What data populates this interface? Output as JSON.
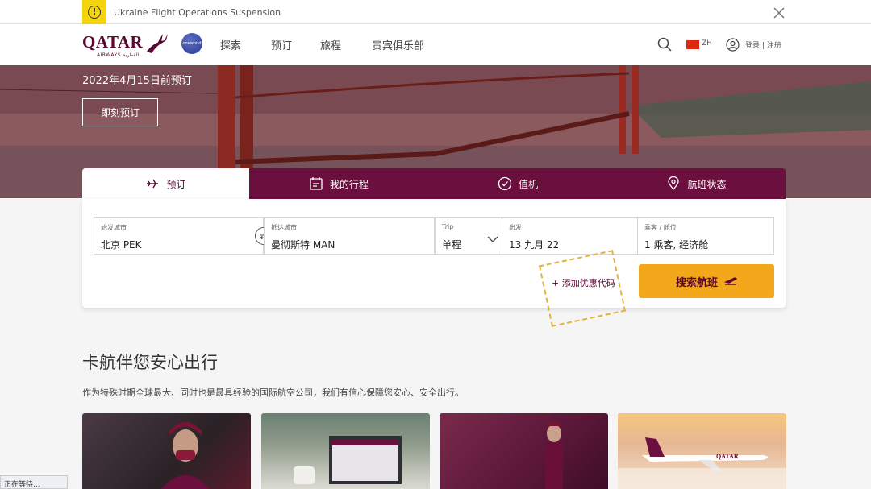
{
  "alert": {
    "text": "Ukraine Flight Operations Suspension",
    "icon": "warning-icon",
    "color": "#f4d40f"
  },
  "header": {
    "logo": "QATAR",
    "logo_sub": "AIRWAYS القطرية",
    "alliance": "oneworld",
    "nav": [
      "探索",
      "预订",
      "旅程",
      "贵宾俱乐部"
    ],
    "lang": "ZH",
    "login": "登录 | 注册"
  },
  "hero": {
    "date": "2022年4月15日前预订",
    "button": "即刻预订"
  },
  "tabs": [
    {
      "label": "预订",
      "icon": "plane-icon"
    },
    {
      "label": "我的行程",
      "icon": "itinerary-icon"
    },
    {
      "label": "值机",
      "icon": "checkin-icon"
    },
    {
      "label": "航班状态",
      "icon": "location-pin-icon"
    }
  ],
  "booking": {
    "from_label": "始发城市",
    "from_value": "北京 PEK",
    "to_label": "抵达城市",
    "to_value": "曼彻斯特 MAN",
    "trip_label": "Trip",
    "trip_value": "单程",
    "depart_label": "出发",
    "depart_value": "13 九月 22",
    "pax_label": "乘客 / 舱位",
    "pax_value": "1 乘客, 经济舱",
    "promo": "+ 添加优惠代码",
    "search": "搜索航班"
  },
  "section": {
    "title": "卡航伴您安心出行",
    "desc": "作为特殊时期全球最大、同时也是最具经验的国际航空公司，我们有信心保障您安心、安全出行。"
  },
  "cards": [
    "QATAR"
  ],
  "status": "正在等待..."
}
